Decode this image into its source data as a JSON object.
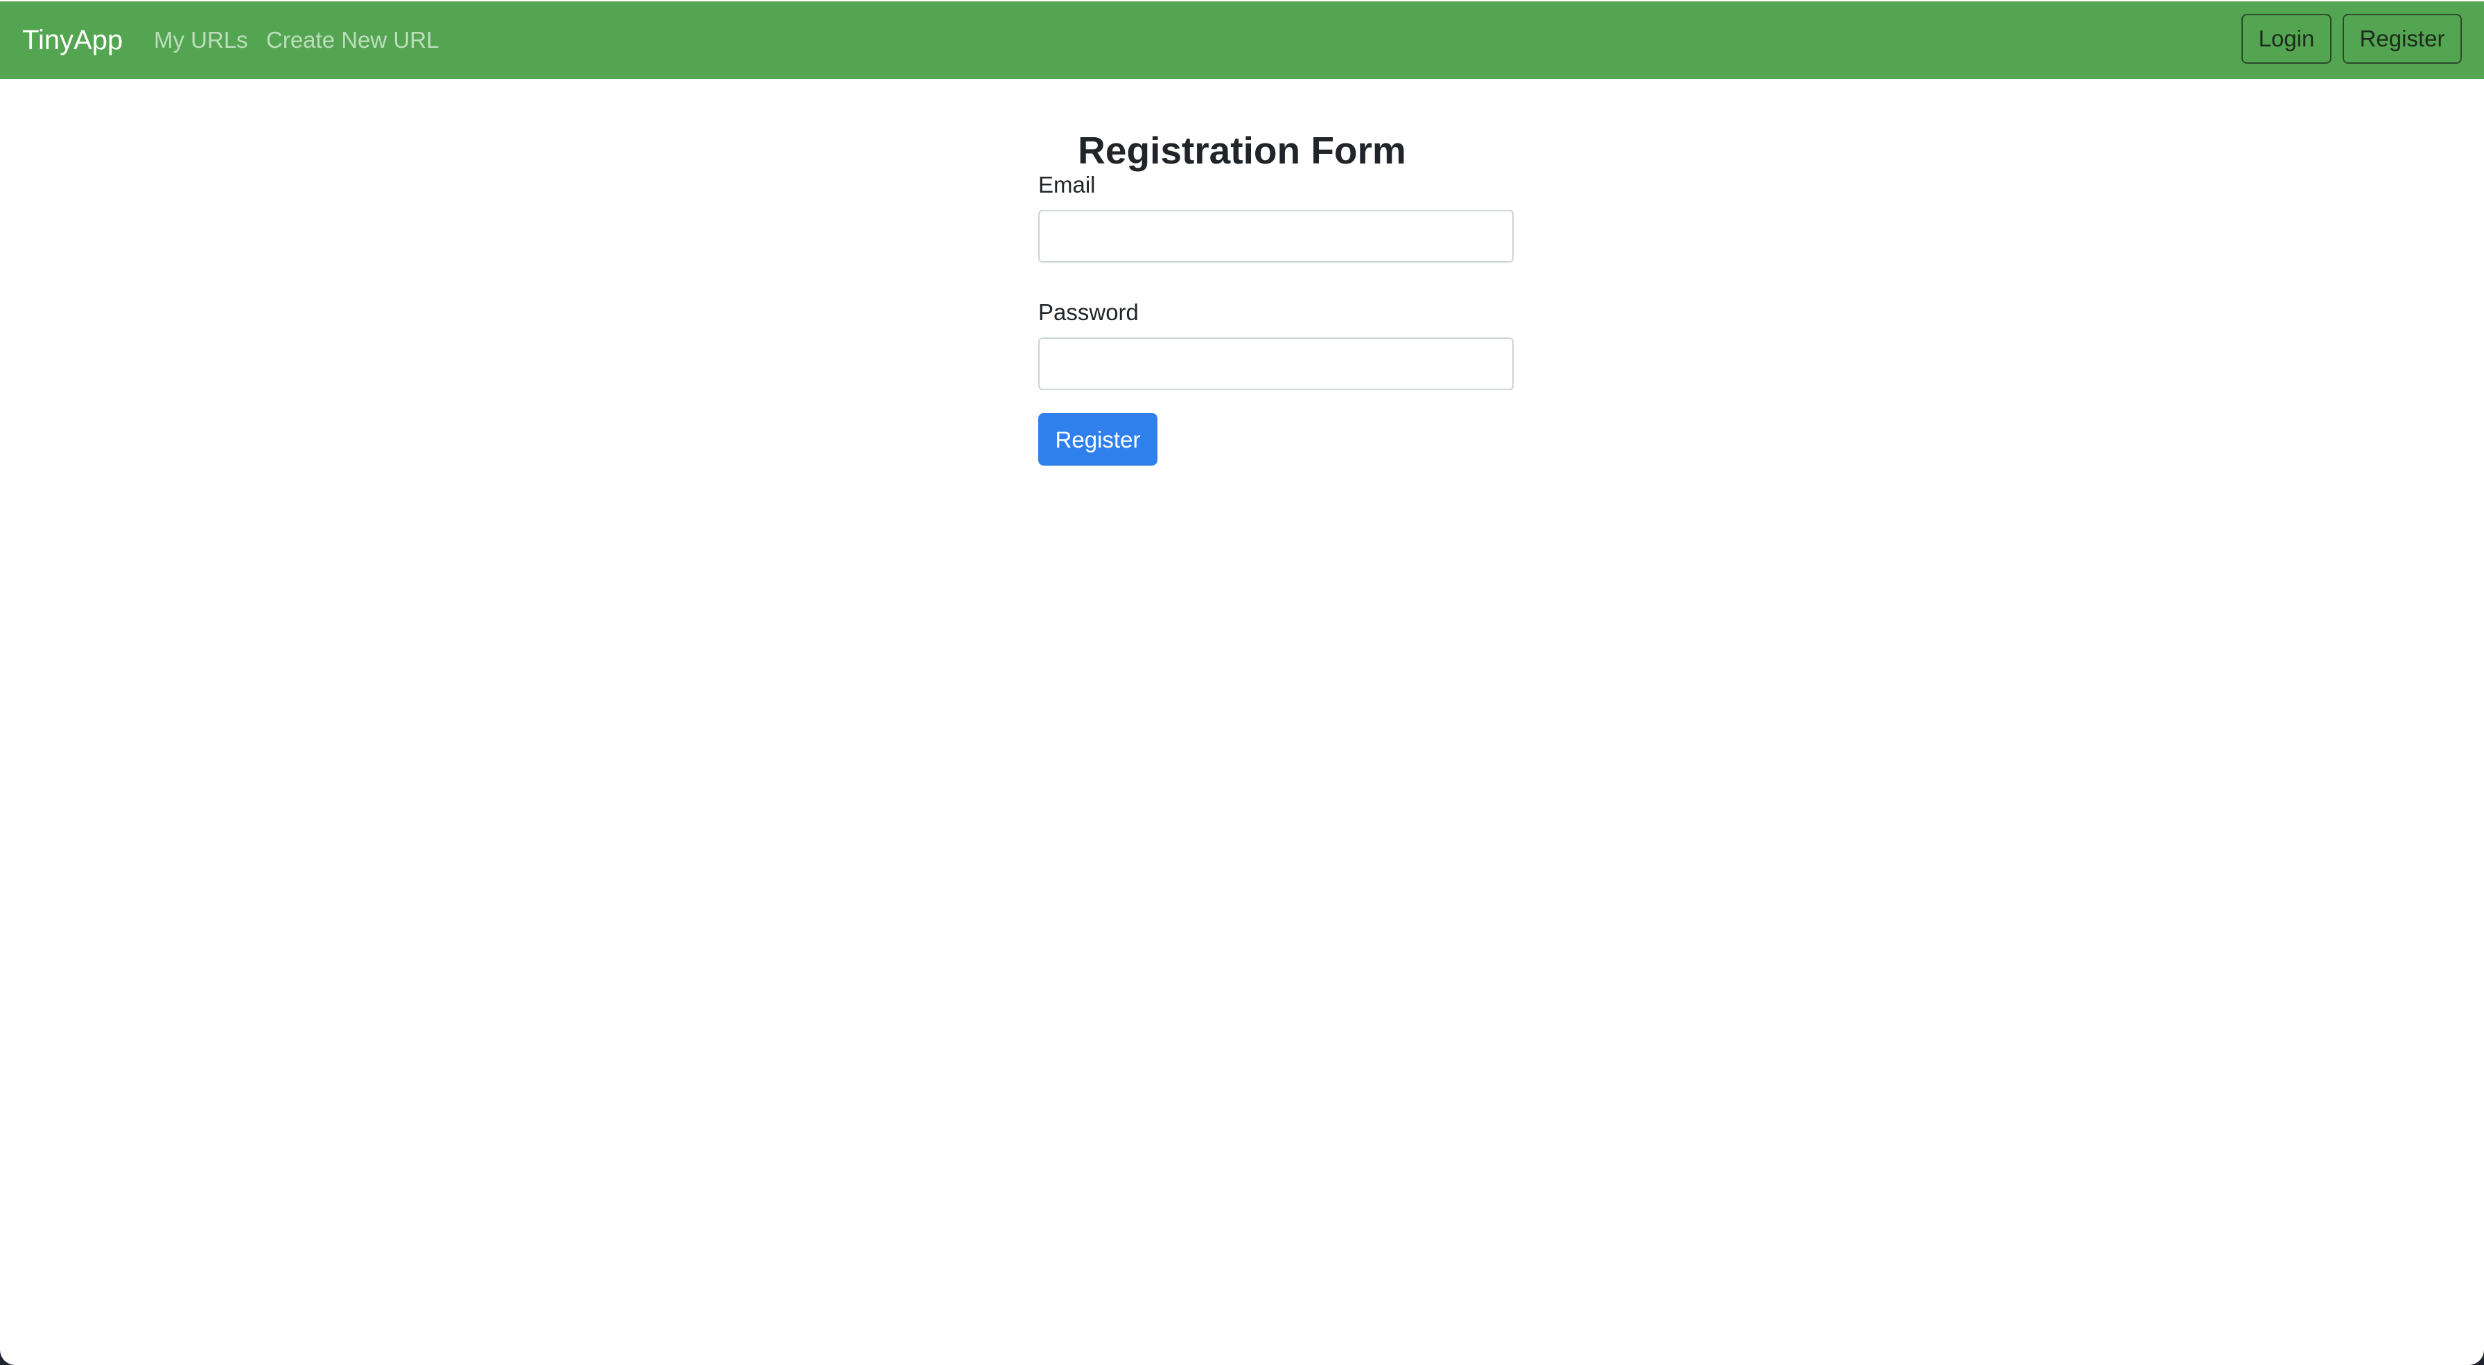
{
  "navbar": {
    "brand": "TinyApp",
    "links": [
      {
        "label": "My URLs"
      },
      {
        "label": "Create New URL"
      }
    ],
    "login_label": "Login",
    "register_label": "Register",
    "background_color": "#53a551"
  },
  "form": {
    "title": "Registration Form",
    "email_label": "Email",
    "email_value": "",
    "password_label": "Password",
    "password_value": "",
    "submit_label": "Register",
    "submit_color": "#2f80ed"
  }
}
